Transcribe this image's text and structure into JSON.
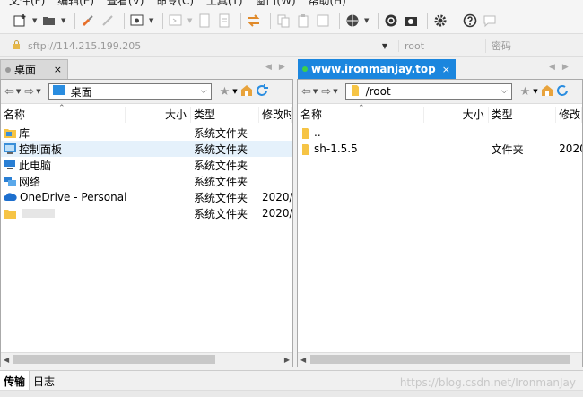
{
  "menubar": [
    "文件(F)",
    "编辑(E)",
    "查看(V)",
    "命令(C)",
    "工具(T)",
    "窗口(W)",
    "帮助(H)"
  ],
  "address": {
    "host": "sftp://114.215.199.205",
    "user": "root",
    "password_placeholder": "密码"
  },
  "tabs": {
    "left": "桌面",
    "right": "www.ironmanjay.top",
    "close": "×"
  },
  "left": {
    "path": "桌面",
    "columns": [
      "名称",
      "大小",
      "类型",
      "修改时"
    ],
    "rows": [
      {
        "name": "库",
        "size": "",
        "type": "系统文件夹",
        "modified": "",
        "icon": "library-icon"
      },
      {
        "name": "控制面板",
        "size": "",
        "type": "系统文件夹",
        "modified": "",
        "icon": "control-panel-icon"
      },
      {
        "name": "此电脑",
        "size": "",
        "type": "系统文件夹",
        "modified": "",
        "icon": "computer-icon"
      },
      {
        "name": "网络",
        "size": "",
        "type": "系统文件夹",
        "modified": "",
        "icon": "network-icon"
      },
      {
        "name": "OneDrive - Personal",
        "size": "",
        "type": "系统文件夹",
        "modified": "2020/",
        "icon": "onedrive-icon"
      },
      {
        "name": "",
        "size": "",
        "type": "系统文件夹",
        "modified": "2020/",
        "icon": "user-folder-icon"
      }
    ]
  },
  "right": {
    "path": "/root",
    "columns": [
      "名称",
      "大小",
      "类型",
      "修改"
    ],
    "rows": [
      {
        "name": "..",
        "size": "",
        "type": "",
        "modified": "",
        "icon": "folder-up-icon"
      },
      {
        "name": "sh-1.5.5",
        "size": "",
        "type": "文件夹",
        "modified": "2020",
        "icon": "folder-icon"
      }
    ]
  },
  "bottom_tabs": [
    "传输",
    "日志"
  ],
  "watermark": "https://blog.csdn.net/IronmanJay",
  "colors": {
    "accent": "#1b86de",
    "folder": "#f6c445",
    "home": "#e8a33c"
  }
}
